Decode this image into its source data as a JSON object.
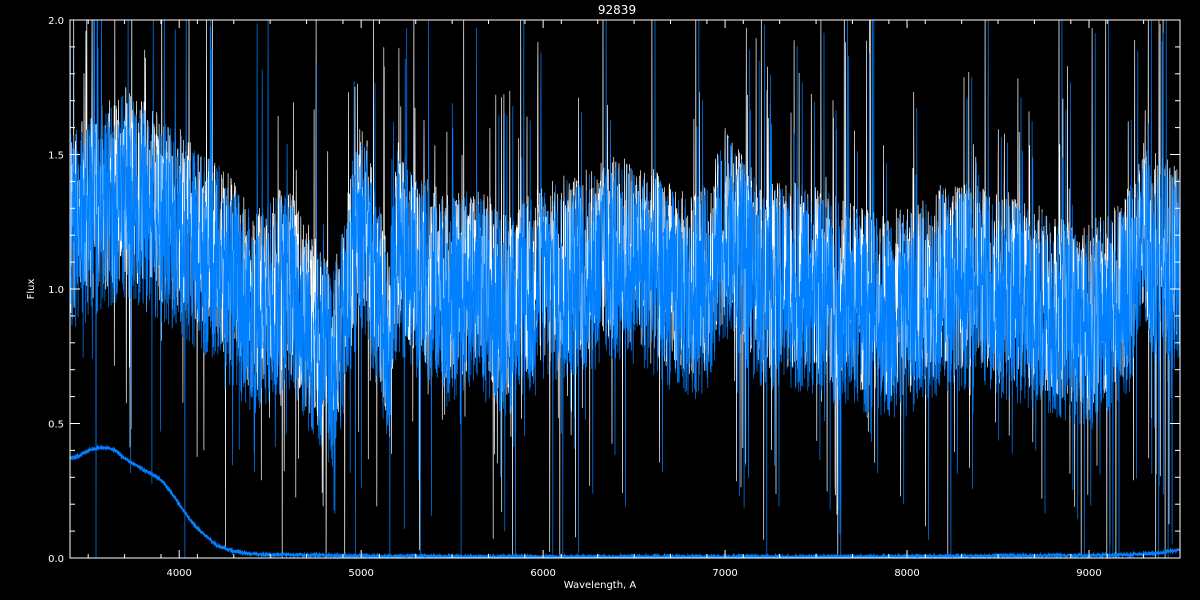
{
  "chart_data": {
    "type": "line",
    "title": "92839",
    "xlabel": "Wavelength, A",
    "ylabel": "Flux",
    "xlim": [
      3400,
      9500
    ],
    "ylim": [
      0.0,
      2.0
    ],
    "x_ticks": [
      4000,
      5000,
      6000,
      7000,
      8000,
      9000
    ],
    "y_ticks": [
      0.0,
      0.5,
      1.0,
      1.5,
      2.0
    ],
    "y_tick_labels": [
      "0.0",
      "0.5",
      "1.0",
      "1.5",
      "2.0"
    ],
    "grid": false,
    "background": "#000000",
    "axis_color": "#ffffff",
    "series": [
      {
        "color": "#ffffff",
        "noise_amplitude": 0.35,
        "x": [
          3400,
          3500,
          3600,
          3700,
          3800,
          3900,
          4000,
          4100,
          4200,
          4300,
          4400,
          4500,
          4600,
          4700,
          4800,
          4850,
          4900,
          5000,
          5100,
          5150,
          5200,
          5300,
          5400,
          5500,
          5600,
          5700,
          5800,
          5900,
          6000,
          6200,
          6400,
          6500,
          6600,
          6800,
          6900,
          7000,
          7200,
          7400,
          7600,
          7800,
          8000,
          8200,
          8400,
          8600,
          8800,
          9000,
          9100,
          9200,
          9300,
          9400,
          9500
        ],
        "y": [
          1.25,
          1.3,
          1.35,
          1.4,
          1.35,
          1.3,
          1.25,
          1.2,
          1.15,
          1.05,
          0.95,
          1.0,
          1.05,
          0.9,
          0.8,
          0.75,
          0.9,
          1.3,
          1.0,
          0.8,
          1.2,
          1.1,
          1.05,
          1.0,
          1.05,
          1.0,
          0.95,
          1.0,
          1.05,
          1.1,
          1.15,
          1.15,
          1.1,
          1.0,
          1.05,
          1.25,
          1.05,
          1.05,
          1.0,
          0.95,
          0.95,
          1.05,
          1.05,
          1.0,
          0.95,
          0.9,
          0.95,
          1.0,
          1.2,
          1.15,
          1.1
        ]
      },
      {
        "color": "#0080ff",
        "noise_amplitude": 0.38,
        "x": [
          3400,
          3500,
          3600,
          3700,
          3800,
          3900,
          4000,
          4100,
          4200,
          4300,
          4400,
          4500,
          4600,
          4700,
          4800,
          4850,
          4900,
          5000,
          5100,
          5150,
          5200,
          5300,
          5400,
          5500,
          5600,
          5700,
          5800,
          5900,
          6000,
          6200,
          6400,
          6500,
          6600,
          6800,
          6900,
          7000,
          7200,
          7400,
          7600,
          7800,
          8000,
          8200,
          8400,
          8600,
          8800,
          9000,
          9100,
          9200,
          9300,
          9400,
          9500
        ],
        "y": [
          1.2,
          1.25,
          1.3,
          1.35,
          1.3,
          1.25,
          1.2,
          1.15,
          1.1,
          1.0,
          0.9,
          0.95,
          1.0,
          0.85,
          0.75,
          0.7,
          0.85,
          1.25,
          0.95,
          0.75,
          1.15,
          1.05,
          1.0,
          0.95,
          1.0,
          0.95,
          0.9,
          0.95,
          1.0,
          1.05,
          1.1,
          1.1,
          1.05,
          0.95,
          1.0,
          1.2,
          1.0,
          1.0,
          0.95,
          0.9,
          0.9,
          1.0,
          1.0,
          0.95,
          0.9,
          0.85,
          0.9,
          0.95,
          1.15,
          1.1,
          1.05
        ]
      },
      {
        "color": "#0080ff",
        "noise_amplitude": 0.004,
        "x": [
          3400,
          3450,
          3500,
          3550,
          3600,
          3650,
          3700,
          3750,
          3800,
          3850,
          3900,
          3950,
          4000,
          4050,
          4100,
          4150,
          4200,
          4250,
          4300,
          4400,
          4500,
          4600,
          4800,
          5000,
          5500,
          6000,
          6500,
          7000,
          7500,
          8000,
          8500,
          9000,
          9200,
          9400,
          9500
        ],
        "y": [
          0.37,
          0.38,
          0.4,
          0.41,
          0.41,
          0.4,
          0.37,
          0.35,
          0.33,
          0.31,
          0.29,
          0.25,
          0.2,
          0.15,
          0.11,
          0.08,
          0.05,
          0.035,
          0.025,
          0.015,
          0.012,
          0.012,
          0.01,
          0.008,
          0.006,
          0.005,
          0.005,
          0.005,
          0.005,
          0.006,
          0.008,
          0.01,
          0.012,
          0.02,
          0.03
        ]
      }
    ]
  }
}
